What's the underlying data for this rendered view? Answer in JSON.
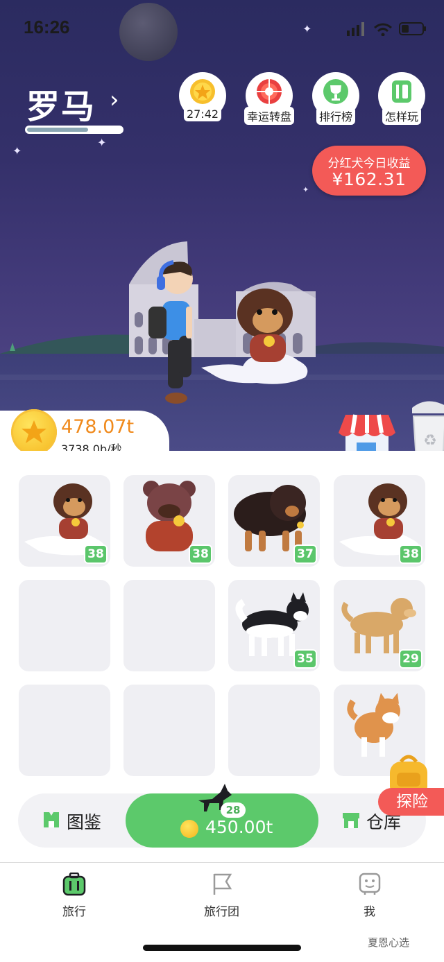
{
  "status_bar": {
    "time": "16:26"
  },
  "header": {
    "city_name": "罗马",
    "city_progress": 0.65
  },
  "top_buttons": [
    {
      "id": "timer",
      "label": "27:42",
      "icon": "gold-coin-star-icon"
    },
    {
      "id": "lucky_wheel",
      "label": "幸运转盘",
      "icon": "wheel-icon"
    },
    {
      "id": "leaderboard",
      "label": "排行榜",
      "icon": "trophy-icon"
    },
    {
      "id": "how_to_play",
      "label": "怎样玩",
      "icon": "book-icon"
    }
  ],
  "dividend": {
    "title": "分红犬今日收益",
    "amount": "¥162.31"
  },
  "wallet": {
    "coins": "478.07t",
    "rate": "3738.0b/秒"
  },
  "grid": [
    {
      "pet": "tibetan-mastiff-on-cloud",
      "level": "38"
    },
    {
      "pet": "bear-pet-red",
      "level": "38"
    },
    {
      "pet": "black-mastiff",
      "level": "37"
    },
    {
      "pet": "tibetan-mastiff-on-cloud",
      "level": "38"
    },
    {
      "pet": "",
      "level": ""
    },
    {
      "pet": "",
      "level": ""
    },
    {
      "pet": "black-white-husky",
      "level": "35"
    },
    {
      "pet": "golden-retriever",
      "level": "29"
    },
    {
      "pet": "",
      "level": ""
    },
    {
      "pet": "",
      "level": ""
    },
    {
      "pet": "",
      "level": ""
    },
    {
      "pet": "shiba-inu",
      "level": ""
    }
  ],
  "action_bar": {
    "codex_label": "图鉴",
    "buy_level": "28",
    "buy_price": "450.00t",
    "depot_label": "仓库",
    "explore_label": "探险"
  },
  "tabs": [
    {
      "label": "旅行",
      "icon": "suitcase-icon",
      "active": true
    },
    {
      "label": "旅行团",
      "icon": "flag-icon",
      "active": false
    },
    {
      "label": "我",
      "icon": "face-icon",
      "active": false
    }
  ],
  "watermark": "夏恩心选",
  "colors": {
    "accent_green": "#5cc96b",
    "accent_red": "#f35a57",
    "coin_orange": "#f08a1c",
    "sky": "#2b2b60"
  }
}
